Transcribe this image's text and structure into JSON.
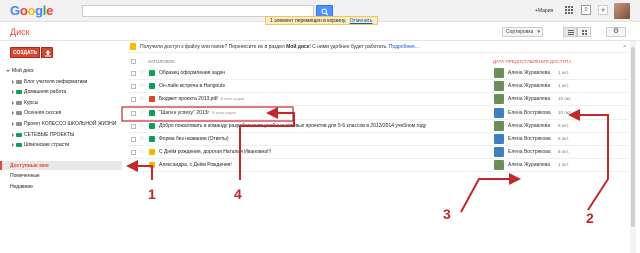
{
  "topbar": {
    "logo": [
      "G",
      "o",
      "o",
      "g",
      "l",
      "e"
    ],
    "user_name": "+Мария",
    "notification_count": "0",
    "notice_text": "1 элемент перемещен в корзину.",
    "notice_undo": "Отменить"
  },
  "toolbar": {
    "app_title": "Диск",
    "sort_label": "Сортировка",
    "settings_icon": "gear-icon"
  },
  "sidebar": {
    "create_label": "СОЗДАТЬ",
    "tree": [
      {
        "label": "Мой диск",
        "depth": 0,
        "color": "",
        "expanded": true
      },
      {
        "label": "Блог учителя информатики",
        "depth": 1,
        "color": "#8f8f8f"
      },
      {
        "label": "Домашняя работа",
        "depth": 1,
        "color": "#0f9d58"
      },
      {
        "label": "Курсы",
        "depth": 1,
        "color": "#8f8f8f"
      },
      {
        "label": "Осенняя сессия",
        "depth": 1,
        "color": "#8f8f8f"
      },
      {
        "label": "Проект КОЛЕССО ШКОЛЬНОЙ ЖИЗНИ",
        "depth": 1,
        "color": "#8f8f8f"
      },
      {
        "label": "СЕТЕВЫЕ ПРОЕКТЫ",
        "depth": 1,
        "color": "#0f9d58"
      },
      {
        "label": "Шпионские страсти",
        "depth": 1,
        "color": "#0f9d58"
      }
    ],
    "nav": [
      {
        "label": "Доступные мне",
        "active": true
      },
      {
        "label": "Помеченные",
        "active": false
      },
      {
        "label": "Недавние",
        "active": false
      }
    ]
  },
  "banner": {
    "text": "Получили доступ к файлу или папке? Перенесите их в раздел",
    "bold": "Мой диск",
    "text2": "! С ними удобнее будет работать.",
    "link": "Подробнее...",
    "close": "×"
  },
  "table": {
    "col_title": "ЗАГОЛОВОК",
    "col_date": "ДАТА ПРЕДОСТАВЛЕНИЯ ДОСТУПА",
    "rows": [
      {
        "title": "Образец оформления задач",
        "meta": "",
        "icon": "#0f9d58",
        "owner": "Алена Журавлева",
        "date": "1 окт.",
        "avatar": "#6b8e5a"
      },
      {
        "title": "Он-лайн встреча в Hangouts",
        "meta": "",
        "icon": "#0f9d58",
        "owner": "Алена Журавлева",
        "date": "1 окт.",
        "avatar": "#6b8e5a"
      },
      {
        "title": "Бюджет проекта 2013.pdf",
        "meta": "В мою кодов",
        "icon": "#db4437",
        "owner": "Алена Журавлева",
        "date": "10 окт.",
        "avatar": "#6b8e5a"
      },
      {
        "title": "\"Шаги к успеху\" 2013г",
        "meta": "В мою кодов",
        "icon": "#0f9d58",
        "owner": "Елена Вострякова",
        "date": "10 окт.",
        "avatar": "#3f7fbf"
      },
      {
        "title": "Добро пожаловать в команду разработчиков учебных сетевых проектов для 5-6 классов в 2013/2014 учебном году",
        "meta": "",
        "icon": "#0f9d58",
        "owner": "Алена Журавлева",
        "date": "8 окт.",
        "avatar": "#6b8e5a"
      },
      {
        "title": "Форма без названия (Ответы)",
        "meta": "",
        "icon": "#0f9d58",
        "owner": "Елена Вострякова",
        "date": "8 окт.",
        "avatar": "#3f7fbf"
      },
      {
        "title": "С Днём рождения, дорогая Наталия Ивановна!!!",
        "meta": "",
        "icon": "#f4b400",
        "owner": "Елена Вострякова",
        "date": "5 окт.",
        "avatar": "#3f7fbf"
      },
      {
        "title": "Александра, с Днём Рождения!",
        "meta": "",
        "icon": "#f4b400",
        "owner": "Алена Журавлева",
        "date": "1 окт.",
        "avatar": "#6b8e5a"
      }
    ]
  },
  "annotations": {
    "numbers": [
      "1",
      "4",
      "3",
      "2"
    ],
    "color": "#c0282d"
  }
}
